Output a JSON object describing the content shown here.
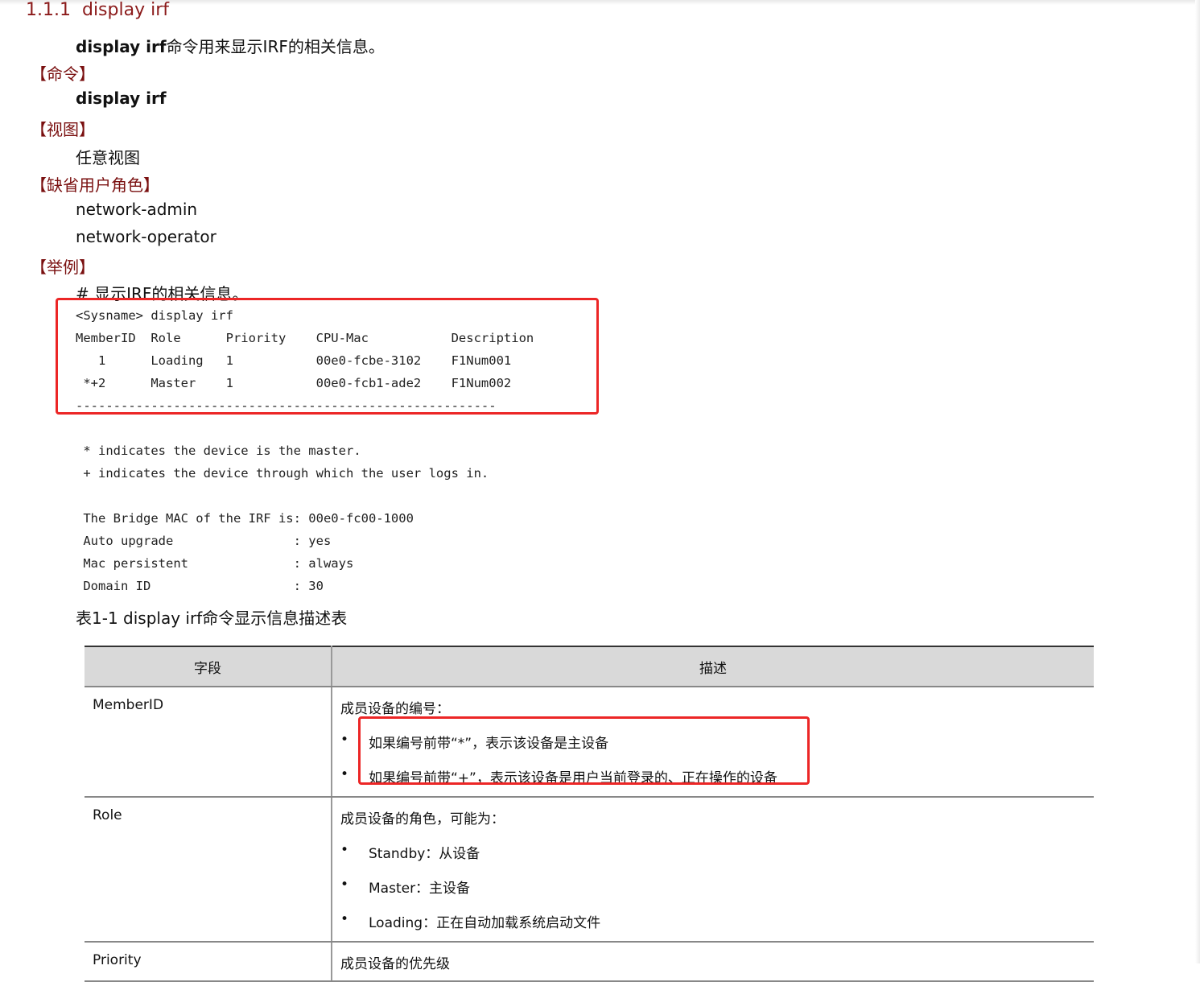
{
  "heading": {
    "number": "1.1.1",
    "title": "display irf"
  },
  "intro": {
    "cmd": "display irf",
    "text": "命令用来显示IRF的相关信息。"
  },
  "sections": {
    "command_label": "【命令】",
    "command": "display irf",
    "view_label": "【视图】",
    "view": "任意视图",
    "roles_label": "【缺省用户角色】",
    "roles": [
      "network-admin",
      "network-operator"
    ],
    "example_label": "【举例】",
    "example_comment": "# 显示IRF的相关信息。"
  },
  "output": {
    "prompt": "<Sysname> display irf",
    "header": "MemberID  Role      Priority    CPU-Mac           Description",
    "rows": [
      "   1      Loading   1           00e0-fcbe-3102    F1Num001",
      " *+2      Master    1           00e0-fcb1-ade2    F1Num002"
    ],
    "separator": "--------------------------------------------------------",
    "notes": [
      " * indicates the device is the master.",
      " + indicates the device through which the user logs in."
    ],
    "info": [
      " The Bridge MAC of the IRF is: 00e0-fc00-1000",
      " Auto upgrade                : yes",
      " Mac persistent              : always",
      " Domain ID                   : 30"
    ]
  },
  "table": {
    "caption": "表1-1 display irf命令显示信息描述表",
    "headers": [
      "字段",
      "描述"
    ],
    "rows": [
      {
        "field": "MemberID",
        "intro": "成员设备的编号：",
        "bullets": [
          "如果编号前带“*”，表示该设备是主设备",
          "如果编号前带“+”，表示该设备是用户当前登录的、正在操作的设备"
        ]
      },
      {
        "field": "Role",
        "intro": "成员设备的角色，可能为：",
        "bullets": [
          "Standby：从设备",
          "Master：主设备",
          "Loading：正在自动加载系统启动文件"
        ]
      },
      {
        "field": "Priority",
        "intro": "成员设备的优先级",
        "bullets": []
      }
    ]
  },
  "bullet_char": "•",
  "colors": {
    "heading": "#8b1a1a",
    "section": "#7a1010",
    "highlight": "#ec2626",
    "table_header_bg": "#d9d9d9"
  }
}
